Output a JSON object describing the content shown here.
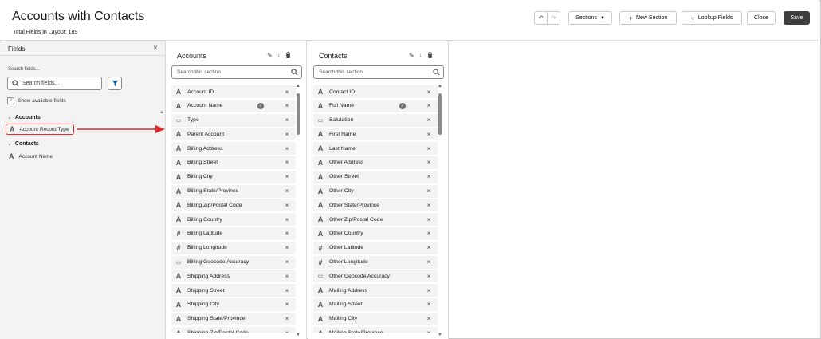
{
  "header": {
    "title": "Accounts with Contacts",
    "subtitle": "Total Fields in Layout: 189",
    "undo_label": "↶",
    "redo_label": "↷",
    "sections_label": "Sections",
    "new_section_label": "New Section",
    "lookup_fields_label": "Lookup Fields",
    "close_label": "Close",
    "save_label": "Save"
  },
  "fields_panel": {
    "title": "Fields",
    "close_glyph": "×",
    "search_label": "Search fields...",
    "search_placeholder": "Search fields...",
    "show_available_label": "Show available fields",
    "show_available_checked": true,
    "groups": [
      {
        "name": "Accounts",
        "items": [
          {
            "label": "Account Record Type",
            "type": "text",
            "highlighted": true
          }
        ]
      },
      {
        "name": "Contacts",
        "items": [
          {
            "label": "Account Name",
            "type": "text"
          }
        ]
      }
    ]
  },
  "sections": [
    {
      "title": "Accounts",
      "search_placeholder": "Search this section",
      "fields": [
        {
          "label": "Account ID",
          "type": "text"
        },
        {
          "label": "Account Name",
          "type": "text",
          "required": true
        },
        {
          "label": "Type",
          "type": "picklist"
        },
        {
          "label": "Parent Account",
          "type": "text"
        },
        {
          "label": "Billing Address",
          "type": "text"
        },
        {
          "label": "Billing Street",
          "type": "text"
        },
        {
          "label": "Billing City",
          "type": "text"
        },
        {
          "label": "Billing State/Province",
          "type": "text"
        },
        {
          "label": "Billing Zip/Postal Code",
          "type": "text"
        },
        {
          "label": "Billing Country",
          "type": "text"
        },
        {
          "label": "Billing Latitude",
          "type": "number"
        },
        {
          "label": "Billing Longitude",
          "type": "number"
        },
        {
          "label": "Billing Geocode Accuracy",
          "type": "picklist"
        },
        {
          "label": "Shipping Address",
          "type": "text"
        },
        {
          "label": "Shipping Street",
          "type": "text"
        },
        {
          "label": "Shipping City",
          "type": "text"
        },
        {
          "label": "Shipping State/Province",
          "type": "text"
        },
        {
          "label": "Shipping Zip/Postal Code",
          "type": "text"
        }
      ]
    },
    {
      "title": "Contacts",
      "search_placeholder": "Search this section",
      "fields": [
        {
          "label": "Contact ID",
          "type": "text"
        },
        {
          "label": "Full Name",
          "type": "text",
          "required": true
        },
        {
          "label": "Salutation",
          "type": "picklist"
        },
        {
          "label": "First Name",
          "type": "text"
        },
        {
          "label": "Last Name",
          "type": "text"
        },
        {
          "label": "Other Address",
          "type": "text"
        },
        {
          "label": "Other Street",
          "type": "text"
        },
        {
          "label": "Other City",
          "type": "text"
        },
        {
          "label": "Other State/Province",
          "type": "text"
        },
        {
          "label": "Other Zip/Postal Code",
          "type": "text"
        },
        {
          "label": "Other Country",
          "type": "text"
        },
        {
          "label": "Other Latitude",
          "type": "number"
        },
        {
          "label": "Other Longitude",
          "type": "number"
        },
        {
          "label": "Other Geocode Accuracy",
          "type": "picklist"
        },
        {
          "label": "Mailing Address",
          "type": "text"
        },
        {
          "label": "Mailing Street",
          "type": "text"
        },
        {
          "label": "Mailing City",
          "type": "text"
        },
        {
          "label": "Mailing State/Province",
          "type": "text"
        }
      ]
    }
  ],
  "icons": {
    "text": "A",
    "number": "#",
    "picklist": "▭",
    "remove": "×",
    "required": "✓",
    "edit": "✎",
    "move_down": "↓",
    "delete": "🗑"
  },
  "colors": {
    "highlight": "#e02828",
    "primary_button": "#3e3e3c",
    "filter_icon": "#0b5cab"
  }
}
